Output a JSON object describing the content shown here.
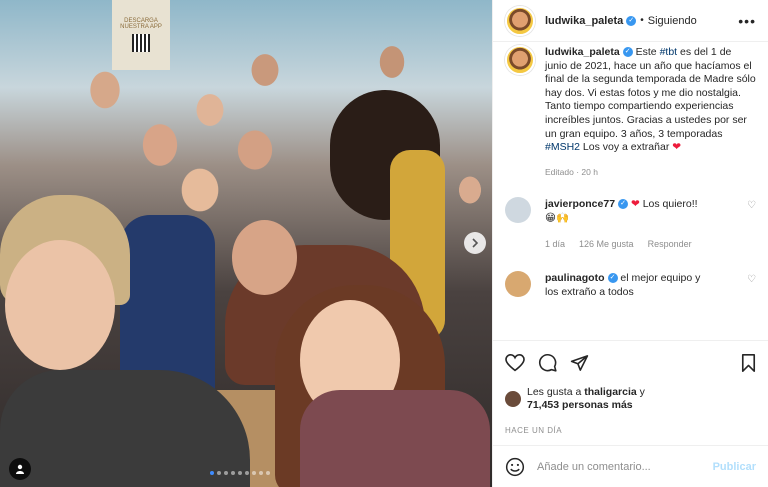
{
  "post": {
    "author": "ludwika_paleta",
    "separator": "•",
    "following_label": "Siguiendo",
    "more_label": "•••",
    "caption": {
      "author": "ludwika_paleta",
      "part1": "Este ",
      "tag1": "#tbt",
      "part2": " es del 1 de junio de 2021, hace un año que hacíamos el final de la segunda temporada de Madre sólo hay dos. Vi estas fotos y me dio nostalgia. Tanto tiempo compartiendo experiencias increíbles juntos. Gracias a ustedes por ser un gran equipo. 3 años, 3 temporadas ",
      "tag2": "#MSH2",
      "part3": " Los voy a extrañar ",
      "heart": "❤"
    },
    "edited": "Editado · 20 h",
    "comments": [
      {
        "author": "javierponce77",
        "text": " Los quiero!!",
        "heart": "❤",
        "emoji": "😁🙌",
        "time": "1 día",
        "likes": "126 Me gusta",
        "reply": "Responder",
        "avatar_color": "#cfd8e0"
      },
      {
        "author": "paulinagoto",
        "text": " el mejor equipo y",
        "tail": "los extraño a todos",
        "avatar_color": "#d8a870"
      }
    ],
    "likes_text_prefix": "Les gusta a ",
    "likes_user": "thaligarcia",
    "likes_text_mid": " y",
    "likes_count": "71,453 personas más",
    "date": "HACE UN DÍA",
    "comment_placeholder": "Añade un comentario...",
    "publish_label": "Publicar",
    "carousel": {
      "total": 9,
      "active": 1
    },
    "photo_poster_text": "DESCARGA NUESTRA APP"
  },
  "colors": {
    "accent": "#3897f0",
    "heart": "#ed1c3c",
    "publish": "#b2dffc"
  }
}
